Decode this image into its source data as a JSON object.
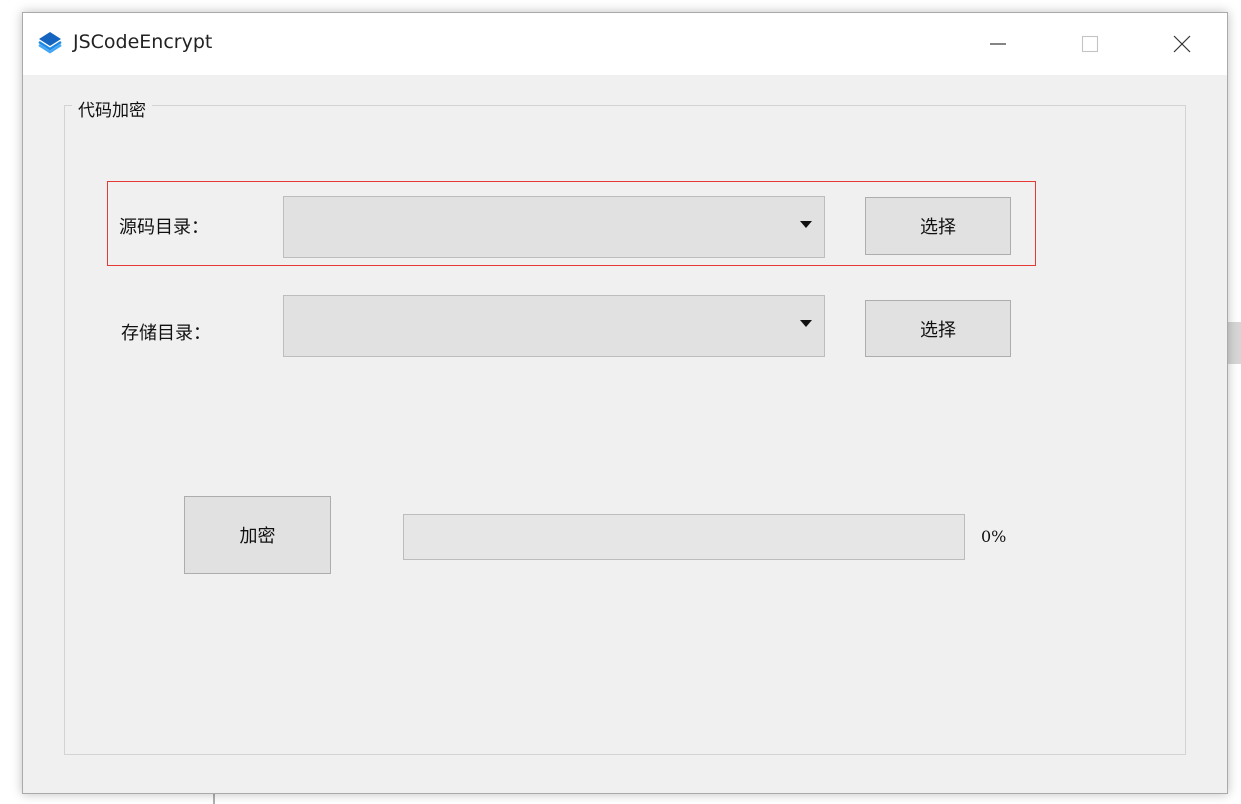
{
  "window": {
    "title": "JSCodeEncrypt",
    "controls": {
      "minimize": "minimize-icon",
      "maximize": "maximize-icon",
      "close": "close-icon"
    }
  },
  "group": {
    "legend": "代码加密"
  },
  "source_dir": {
    "label": "源码目录：",
    "value": "",
    "button_label": "选择"
  },
  "output_dir": {
    "label": "存储目录：",
    "value": "",
    "button_label": "选择"
  },
  "encrypt_button_label": "加密",
  "progress": {
    "value": 0,
    "text": "0%"
  },
  "colors": {
    "highlight": "#e53935",
    "window_bg": "#f0f0f0",
    "control_bg": "#e1e1e1"
  }
}
